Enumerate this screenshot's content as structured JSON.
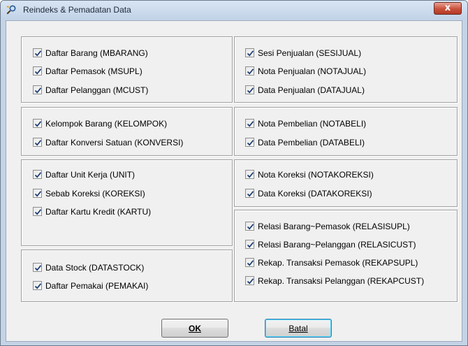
{
  "window": {
    "title": "Reindeks & Pemadatan Data",
    "close_glyph": "x"
  },
  "buttons": {
    "ok": "OK",
    "cancel": "Batal"
  },
  "checkboxes": {
    "left1": [
      "Daftar Barang (MBARANG)",
      "Daftar Pemasok (MSUPL)",
      "Daftar Pelanggan (MCUST)"
    ],
    "left2": [
      "Kelompok Barang (KELOMPOK)",
      "Daftar Konversi Satuan (KONVERSI)"
    ],
    "left3": [
      "Daftar Unit Kerja (UNIT)",
      "Sebab Koreksi (KOREKSI)",
      "Daftar Kartu Kredit (KARTU)"
    ],
    "left4": [
      "Data Stock (DATASTOCK)",
      "Daftar Pemakai (PEMAKAI)"
    ],
    "right1": [
      "Sesi Penjualan (SESIJUAL)",
      "Nota Penjualan (NOTAJUAL)",
      "Data Penjualan (DATAJUAL)"
    ],
    "right2": [
      "Nota Pembelian (NOTABELI)",
      "Data Pembelian (DATABELI)"
    ],
    "right3": [
      "Nota Koreksi (NOTAKOREKSI)",
      "Data Koreksi (DATAKOREKSI)"
    ],
    "right4": [
      "Relasi Barang~Pemasok (RELASISUPL)",
      "Relasi Barang~Pelanggan (RELASICUST)",
      "Rekap. Transaksi Pemasok (REKAPSUPL)",
      "Rekap. Transaksi Pelanggan (REKAPCUST)"
    ]
  },
  "icons": {
    "app": "gear-icon",
    "close": "close-icon",
    "check": "checkmark-icon"
  }
}
